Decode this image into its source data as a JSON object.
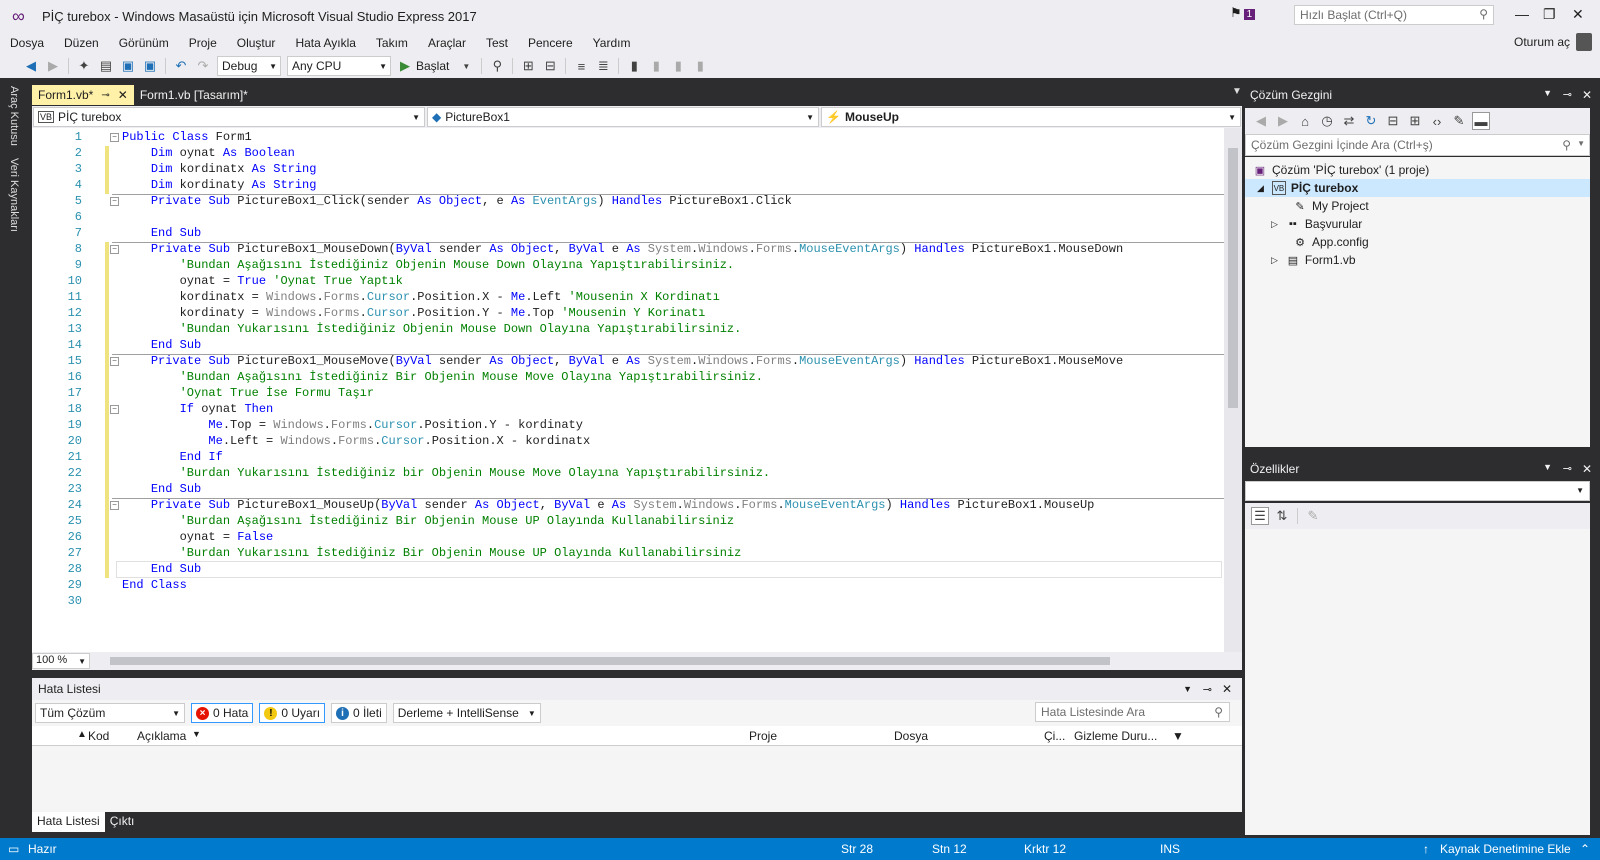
{
  "window": {
    "title": "PİÇ turebox - Windows Masaüstü için Microsoft Visual Studio Express 2017",
    "notification_count": "1",
    "quick_launch_placeholder": "Hızlı Başlat (Ctrl+Q)",
    "sign_in": "Oturum aç"
  },
  "menu": [
    "Dosya",
    "Düzen",
    "Görünüm",
    "Proje",
    "Oluştur",
    "Hata Ayıkla",
    "Takım",
    "Araçlar",
    "Test",
    "Pencere",
    "Yardım"
  ],
  "toolbar": {
    "config": "Debug",
    "platform": "Any CPU",
    "start": "Başlat"
  },
  "left_strip": [
    "Araç Kutusu",
    "Veri Kaynakları"
  ],
  "tabs": [
    {
      "label": "Form1.vb*"
    },
    {
      "label": "Form1.vb [Tasarım]*"
    }
  ],
  "nav": {
    "project": "PİÇ turebox",
    "object": "PictureBox1",
    "event": "MouseUp"
  },
  "code_lines": [
    "Public Class Form1",
    "    Dim oynat As Boolean",
    "    Dim kordinatx As String",
    "    Dim kordinaty As String",
    "    Private Sub PictureBox1_Click(sender As Object, e As EventArgs) Handles PictureBox1.Click",
    "",
    "    End Sub",
    "    Private Sub PictureBox1_MouseDown(ByVal sender As Object, ByVal e As System.Windows.Forms.MouseEventArgs) Handles PictureBox1.MouseDown",
    "        'Bundan Aşağısını İstediğiniz Objenin Mouse Down Olayına Yapıştırabilirsiniz.",
    "        oynat = True 'Oynat True Yaptık",
    "        kordinatx = Windows.Forms.Cursor.Position.X - Me.Left 'Mousenin X Kordinatı",
    "        kordinaty = Windows.Forms.Cursor.Position.Y - Me.Top 'Mousenin Y Korinatı",
    "        'Bundan Yukarısını İstediğiniz Objenin Mouse Down Olayına Yapıştırabilirsiniz.",
    "    End Sub",
    "    Private Sub PictureBox1_MouseMove(ByVal sender As Object, ByVal e As System.Windows.Forms.MouseEventArgs) Handles PictureBox1.MouseMove",
    "        'Bundan Aşağısını İstediğiniz Bir Objenin Mouse Move Olayına Yapıştırabilirsiniz.",
    "        'Oynat True İse Formu Taşır",
    "        If oynat Then",
    "            Me.Top = Windows.Forms.Cursor.Position.Y - kordinaty",
    "            Me.Left = Windows.Forms.Cursor.Position.X - kordinatx",
    "        End If",
    "        'Burdan Yukarısını İstediğiniz bir Objenin Mouse Move Olayına Yapıştırabilirsiniz.",
    "    End Sub",
    "    Private Sub PictureBox1_MouseUp(ByVal sender As Object, ByVal e As System.Windows.Forms.MouseEventArgs) Handles PictureBox1.MouseUp",
    "        'Burdan Aşağısını İstediğiniz Bir Objenin Mouse UP Olayında Kullanabilirsiniz",
    "        oynat = False",
    "        'Burdan Yukarısını İstediğiniz Bir Objenin Mouse UP Olayında Kullanabilirsiniz",
    "    End Sub",
    "End Class",
    ""
  ],
  "zoom": "100 %",
  "error_list": {
    "title": "Hata Listesi",
    "scope": "Tüm Çözüm",
    "errors": "0 Hata",
    "warnings": "0 Uyarı",
    "messages": "0 İleti",
    "build_filter": "Derleme + IntelliSense",
    "search_placeholder": "Hata Listesinde Ara",
    "columns": [
      "Kod",
      "Açıklama",
      "Proje",
      "Dosya",
      "Çi...",
      "Gizleme Duru..."
    ]
  },
  "bottom_tabs": [
    "Hata Listesi",
    "Çıktı"
  ],
  "status": {
    "ready": "Hazır",
    "line": "Str 28",
    "col": "Stn 12",
    "char": "Krktr 12",
    "mode": "INS",
    "source_control": "Kaynak Denetimine Ekle"
  },
  "solution_explorer": {
    "title": "Çözüm Gezgini",
    "search_placeholder": "Çözüm Gezgini İçinde Ara (Ctrl+ş)",
    "nodes": [
      {
        "label": "Çözüm 'PİÇ turebox' (1 proje)"
      },
      {
        "label": "PİÇ turebox"
      },
      {
        "label": "My Project"
      },
      {
        "label": "Başvurular"
      },
      {
        "label": "App.config"
      },
      {
        "label": "Form1.vb"
      }
    ]
  },
  "properties": {
    "title": "Özellikler"
  }
}
